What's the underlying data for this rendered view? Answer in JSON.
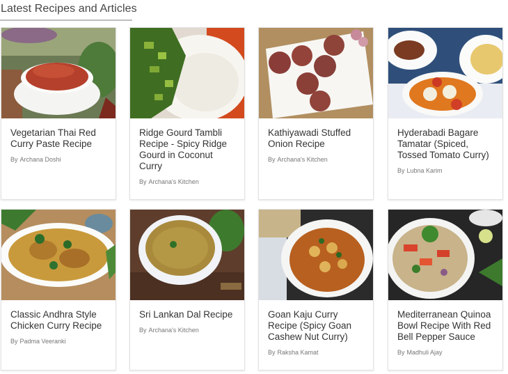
{
  "section": {
    "title": "Latest Recipes and Articles"
  },
  "by_label": "By",
  "cards": [
    {
      "title": "Vegetarian Thai Red Curry Paste Recipe",
      "author": "Archana Doshi"
    },
    {
      "title": "Ridge Gourd Tambli Recipe - Spicy Ridge Gourd in Coconut Curry",
      "author": "Archana's Kitchen"
    },
    {
      "title": "Kathiyawadi Stuffed Onion Recipe",
      "author": "Archana's Kitchen"
    },
    {
      "title": "Hyderabadi Bagare Tamatar (Spiced, Tossed Tomato Curry)",
      "author": "Lubna Karim"
    },
    {
      "title": "Classic Andhra Style Chicken Curry Recipe",
      "author": "Padma Veeranki"
    },
    {
      "title": "Sri Lankan Dal Recipe",
      "author": "Archana's Kitchen"
    },
    {
      "title": "Goan Kaju Curry Recipe (Spicy Goan Cashew Nut Curry)",
      "author": "Raksha Kamat"
    },
    {
      "title": "Mediterranean Quinoa Bowl Recipe With Red Bell Pepper Sauce",
      "author": "Madhuli Ajay"
    }
  ]
}
